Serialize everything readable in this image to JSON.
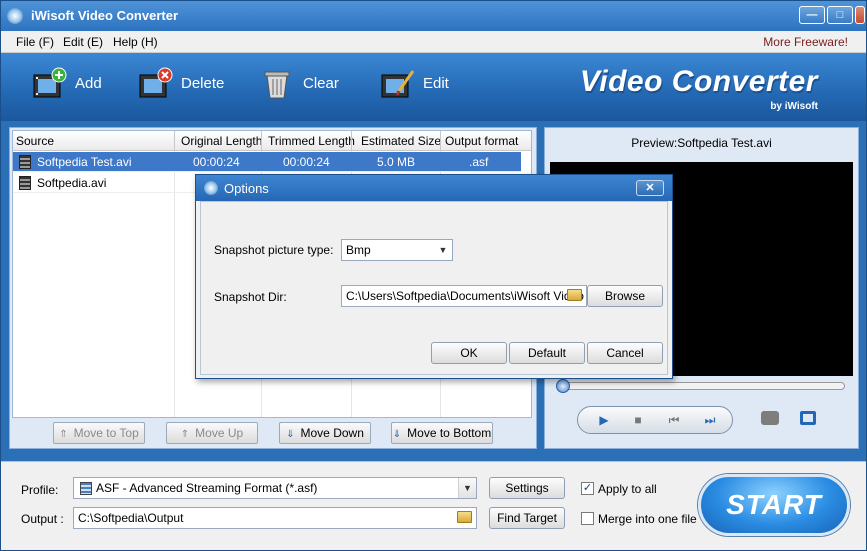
{
  "app": {
    "title": "iWisoft Video Converter"
  },
  "window_controls": {
    "minimize": "—",
    "maximize": "□",
    "close": "✕"
  },
  "menu": {
    "items": [
      "File (F)",
      "Edit (E)",
      "Help (H)"
    ],
    "freeware": "More Freeware!"
  },
  "toolbar": {
    "add": "Add",
    "delete": "Delete",
    "clear": "Clear",
    "edit": "Edit",
    "brand": "Video Converter",
    "brand_sub": "by iWisoft"
  },
  "list": {
    "columns": [
      "Source",
      "Original Length",
      "Trimmed Length",
      "Estimated Size",
      "Output format"
    ],
    "rows": [
      {
        "source": "Softpedia Test.avi",
        "original": "00:00:24",
        "trimmed": "00:00:24",
        "size": "5.0 MB",
        "format": ".asf"
      },
      {
        "source": "Softpedia.avi",
        "original": "",
        "trimmed": "",
        "size": "",
        "format": ""
      }
    ],
    "move_top": "Move to Top",
    "move_up": "Move Up",
    "move_down": "Move Down",
    "move_bottom": "Move to Bottom"
  },
  "preview": {
    "title": "Preview:Softpedia Test.avi"
  },
  "player": {
    "play": "▶",
    "stop": "■",
    "prev": "⏮",
    "next": "⏭"
  },
  "bottom": {
    "profile_label": "Profile:",
    "profile_value": "ASF - Advanced Streaming Format (*.asf)",
    "output_label": "Output :",
    "output_value": "C:\\Softpedia\\Output",
    "settings": "Settings",
    "find_target": "Find Target",
    "apply_all": "Apply to all",
    "apply_all_checked": true,
    "merge": "Merge into one file",
    "merge_checked": false,
    "start": "START"
  },
  "dialog": {
    "title": "Options",
    "close": "✕",
    "snapshot_type_label": "Snapshot picture type:",
    "snapshot_type_value": "Bmp",
    "snapshot_dir_label": "Snapshot Dir:",
    "snapshot_dir_value": "C:\\Users\\Softpedia\\Documents\\iWisoft Video",
    "browse": "Browse",
    "ok": "OK",
    "default": "Default",
    "cancel": "Cancel"
  },
  "colors": {
    "accent": "#2b6fb7",
    "selection": "#3d78c9",
    "brand_text": "#ffffff"
  }
}
